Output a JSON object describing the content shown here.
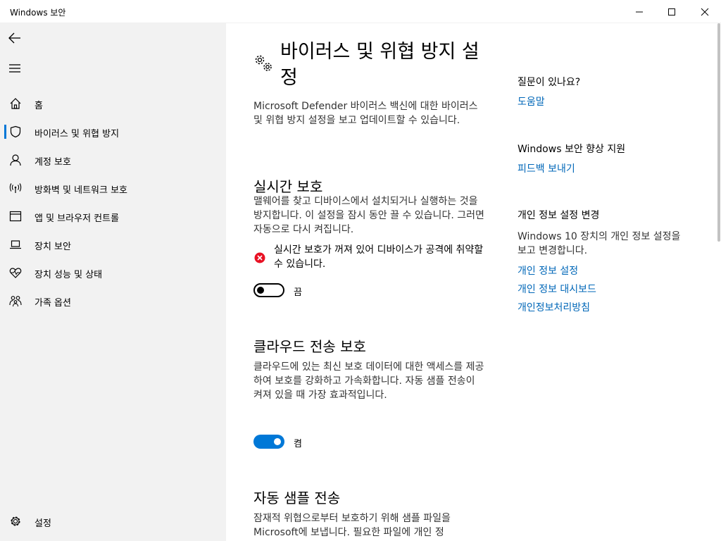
{
  "window": {
    "title": "Windows 보안",
    "controls": [
      "minimize",
      "maximize",
      "close"
    ]
  },
  "sidebar": {
    "items": [
      {
        "label": "홈",
        "icon": "home-icon"
      },
      {
        "label": "바이러스 및 위협 방지",
        "icon": "shield-icon",
        "active": true
      },
      {
        "label": "계정 보호",
        "icon": "person-icon"
      },
      {
        "label": "방화벽 및 네트워크 보호",
        "icon": "antenna-icon"
      },
      {
        "label": "앱 및 브라우저 컨트롤",
        "icon": "browser-window-icon"
      },
      {
        "label": "장치 보안",
        "icon": "laptop-icon"
      },
      {
        "label": "장치 성능 및 상태",
        "icon": "heart-pulse-icon"
      },
      {
        "label": "가족 옵션",
        "icon": "family-icon"
      }
    ],
    "settings_label": "설정"
  },
  "main": {
    "title": "바이러스 및 위협 방지 설정",
    "intro": "Microsoft Defender 바이러스 백신에 대한 바이러스 및 위협 방지 설정을 보고 업데이트할 수 있습니다.",
    "sections": [
      {
        "title": "실시간 보호",
        "description": "맬웨어를 찾고 디바이스에서 설치되거나 실행하는 것을 방지합니다. 이 설정을 잠시 동안 끌 수 있습니다. 그러면 자동으로 다시 켜집니다.",
        "warning": "실시간 보호가 꺼져 있어 디바이스가 공격에 취약할 수 있습니다.",
        "toggle_state": "off",
        "toggle_label": "끔"
      },
      {
        "title": "클라우드 전송 보호",
        "description": "클라우드에 있는 최신 보호 데이터에 대한 액세스를 제공하여 보호를 강화하고 가속화합니다. 자동 샘플 전송이 켜져 있을 때 가장 효과적입니다.",
        "toggle_state": "on",
        "toggle_label": "켬"
      },
      {
        "title": "자동 샘플 전송",
        "description": "잠재적 위협으로부터 보호하기 위해 샘플 파일을 Microsoft에 보냅니다. 필요한 파일에 개인 정"
      }
    ]
  },
  "right": {
    "questions_heading": "질문이 있나요?",
    "help_link": "도움말",
    "improve_heading": "Windows 보안 향상 지원",
    "feedback_link": "피드백 보내기",
    "privacy_heading": "개인 정보 설정 변경",
    "privacy_text": "Windows 10 장치의 개인 정보 설정을 보고 변경합니다.",
    "privacy_links": [
      "개인 정보 설정",
      "개인 정보 대시보드",
      "개인정보처리방침"
    ]
  },
  "colors": {
    "accent": "#0078d7",
    "link": "#0067b8",
    "error": "#e81123",
    "sidebar_bg": "#f2f2f2"
  }
}
